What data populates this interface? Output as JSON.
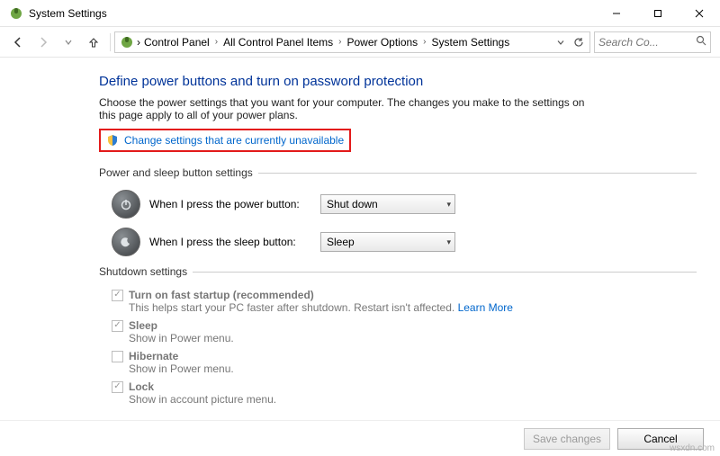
{
  "window": {
    "title": "System Settings"
  },
  "breadcrumb": {
    "items": [
      "Control Panel",
      "All Control Panel Items",
      "Power Options",
      "System Settings"
    ]
  },
  "search": {
    "placeholder": "Search Co..."
  },
  "page": {
    "heading": "Define power buttons and turn on password protection",
    "description": "Choose the power settings that you want for your computer. The changes you make to the settings on this page apply to all of your power plans.",
    "change_link": "Change settings that are currently unavailable"
  },
  "power_group": {
    "label": "Power and sleep button settings",
    "power_button_label": "When I press the power button:",
    "power_button_value": "Shut down",
    "sleep_button_label": "When I press the sleep button:",
    "sleep_button_value": "Sleep"
  },
  "shutdown_group": {
    "label": "Shutdown settings",
    "fast_startup": {
      "label": "Turn on fast startup (recommended)",
      "sub": "This helps start your PC faster after shutdown. Restart isn't affected. ",
      "learn_more": "Learn More",
      "checked": true
    },
    "sleep": {
      "label": "Sleep",
      "sub": "Show in Power menu.",
      "checked": true
    },
    "hibernate": {
      "label": "Hibernate",
      "sub": "Show in Power menu.",
      "checked": false
    },
    "lock": {
      "label": "Lock",
      "sub": "Show in account picture menu.",
      "checked": true
    }
  },
  "footer": {
    "save": "Save changes",
    "cancel": "Cancel"
  },
  "watermark": "wsxdn.com"
}
